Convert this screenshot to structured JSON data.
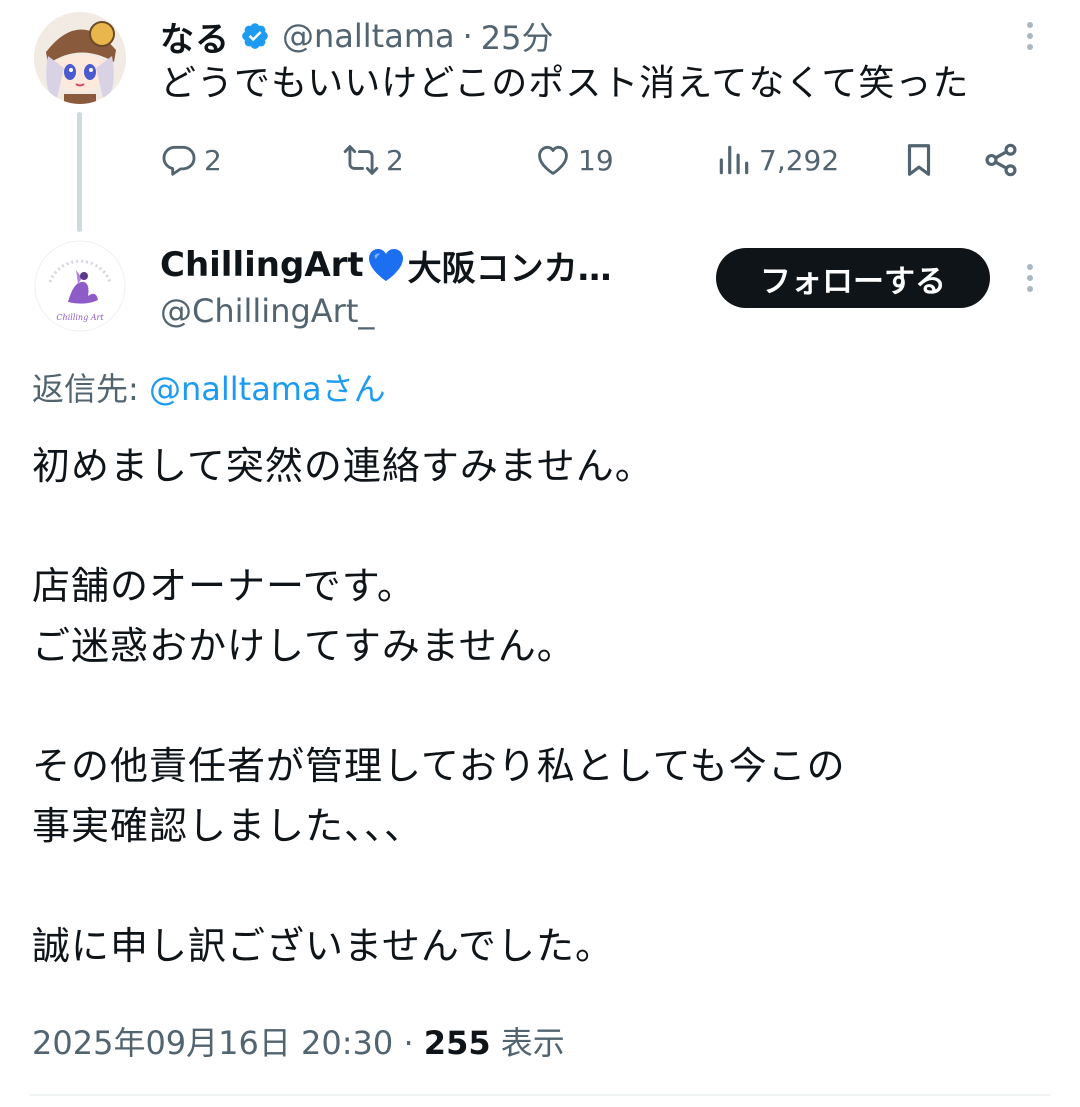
{
  "tweet1": {
    "name": "なる",
    "verified": true,
    "handle": "@nalltama",
    "separator": "·",
    "time": "25分",
    "text": "どうでもいいけどこのポスト消えてなくて笑った",
    "replies": "2",
    "reposts": "2",
    "likes": "19",
    "views": "7,292"
  },
  "tweet2": {
    "name_prefix": "ChillingArt",
    "name_suffix": "大阪コンカ…",
    "handle": "@ChillingArt_",
    "follow_label": "フォローする",
    "replying_prefix": "返信先: ",
    "replying_mention": "@nalltamaさん",
    "lines": [
      "初めまして突然の連絡すみません。",
      "",
      "店舗のオーナーです。",
      "ご迷惑おかけしてすみません。",
      "",
      "その他責任者が管理しており私としても今この",
      "事実確認しました、、、",
      "",
      "誠に申し訳ございませんでした。"
    ],
    "timestamp": "2025年09月16日 20:30",
    "meta_separator": "·",
    "view_count": "255",
    "view_label": "表示"
  },
  "colors": {
    "text": "#0f1419",
    "secondary": "#536471",
    "link": "#1d9bf0",
    "verified": "#1d9bf0",
    "heart": "#1d6ff2",
    "button_bg": "#0f1419"
  },
  "icons": [
    "verified-badge-icon",
    "more-icon",
    "reply-icon",
    "repost-icon",
    "like-icon",
    "views-icon",
    "bookmark-icon",
    "share-icon",
    "blue-heart-icon"
  ]
}
